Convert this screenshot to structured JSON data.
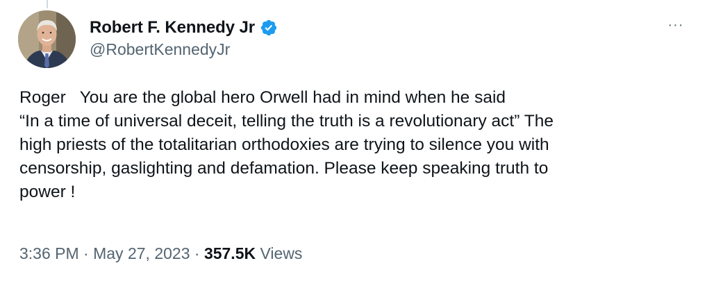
{
  "author": {
    "display_name": "Robert F. Kennedy Jr",
    "handle": "@RobertKennedyJr",
    "verified": true
  },
  "icons": {
    "verified": "verified-badge-icon",
    "more": "more-options-icon",
    "avatar": "profile-photo"
  },
  "more_label": "···",
  "tweet": {
    "text": "Roger   You are the global hero Orwell had in mind when he said\n“In a time of universal deceit, telling the truth is a revolutionary act” The\nhigh priests of the totalitarian orthodoxies are trying to silence you with\ncensorship, gaslighting and defamation. Please keep speaking truth to\npower !",
    "time": "3:36 PM",
    "separator": " · ",
    "date": "May 27, 2023",
    "views_count": "357.5K",
    "views_label": " Views"
  },
  "colors": {
    "verified_blue": "#1d9bf0",
    "text_primary": "#0f1419",
    "text_secondary": "#536471"
  }
}
